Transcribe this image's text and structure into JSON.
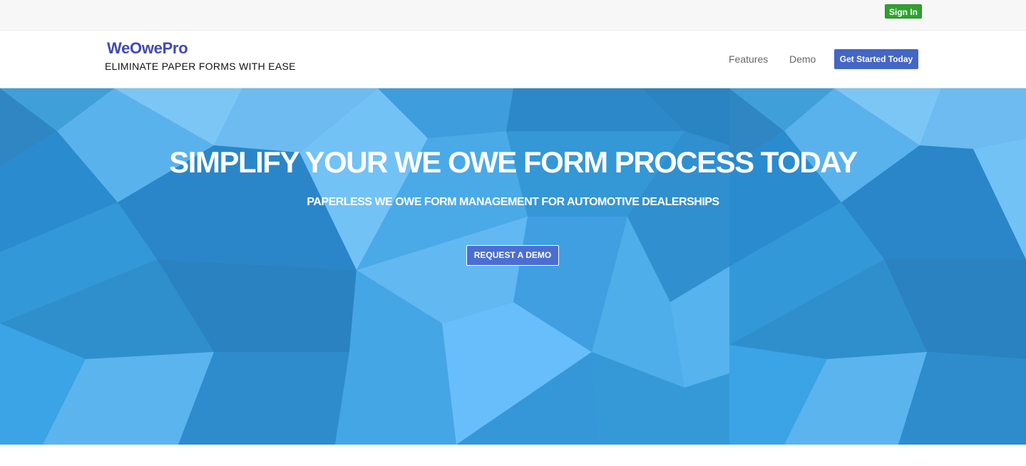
{
  "topbar": {
    "signin_label": "Sign In"
  },
  "header": {
    "brand": "WeOwePro",
    "tagline": "ELIMINATE PAPER FORMS WITH EASE",
    "nav": {
      "features": "Features",
      "demo": "Demo"
    },
    "cta_label": "Get Started Today"
  },
  "hero": {
    "title": "SIMPLIFY YOUR WE OWE FORM PROCESS TODAY",
    "subtitle": "PAPERLESS WE OWE FORM MANAGEMENT FOR AUTOMOTIVE DEALERSHIPS",
    "button_label": "REQUEST A DEMO"
  },
  "colors": {
    "brand": "#3e4bb3",
    "signin": "#2fa12f",
    "cta": "#4466c4",
    "hero_base": "#3aa3e3"
  }
}
